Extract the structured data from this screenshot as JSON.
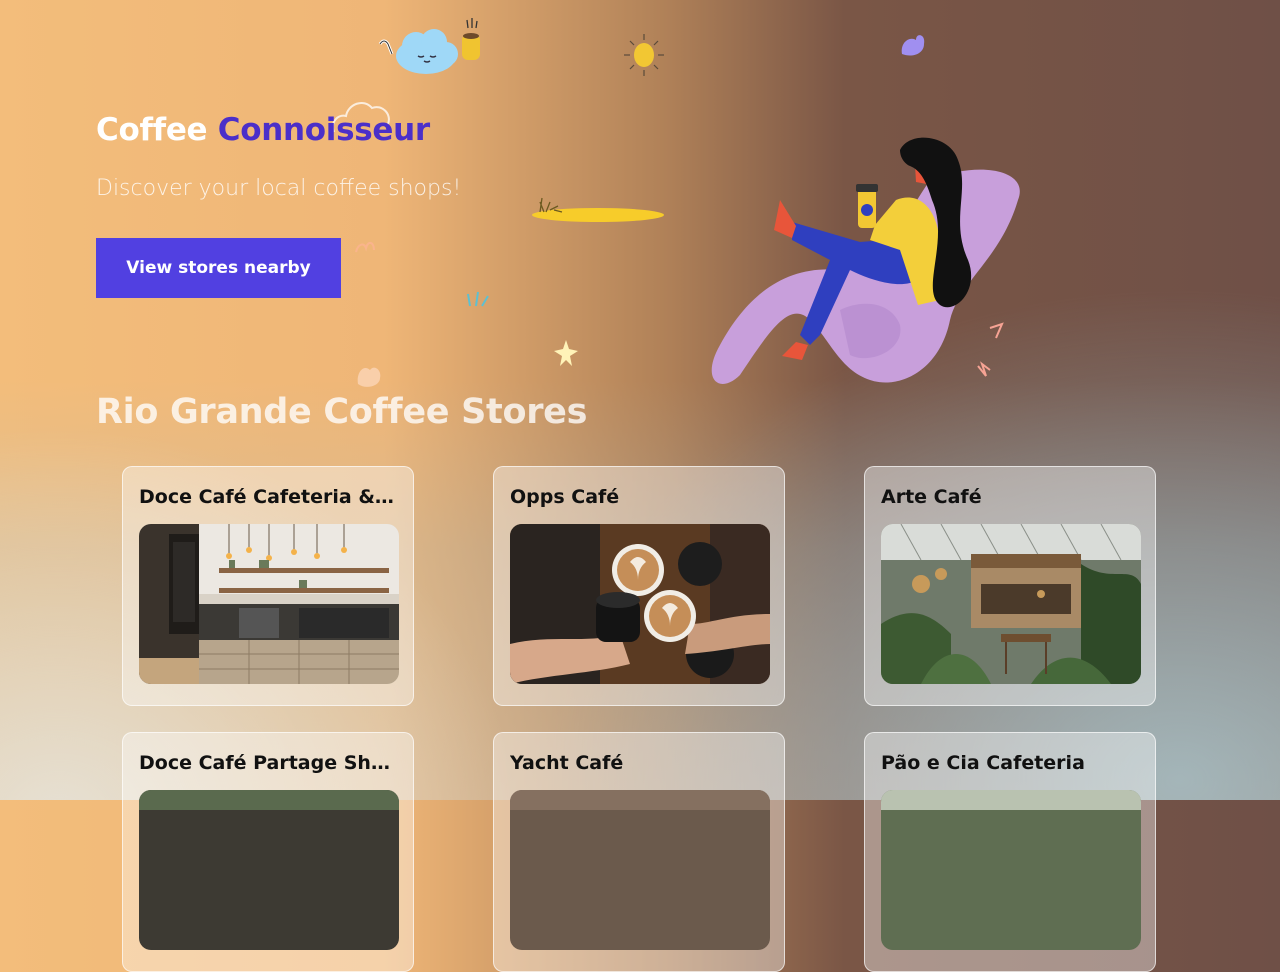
{
  "hero": {
    "title_part1": "Coffee",
    "title_part2": "Connoisseur",
    "subtitle": "Discover your local coffee shops!",
    "cta_label": "View stores nearby"
  },
  "stores_section": {
    "title": "Rio Grande Coffee Stores",
    "cards": [
      {
        "name": "Doce Café Cafeteria & Do...",
        "photo": "cafe-counter-photo"
      },
      {
        "name": "Opps Café",
        "photo": "latte-cheers-photo"
      },
      {
        "name": "Arte Café",
        "photo": "garden-cafe-photo"
      },
      {
        "name": "Doce Café Partage Shopp...",
        "photo": "cafe-photo"
      },
      {
        "name": "Yacht Café",
        "photo": "cafe-photo"
      },
      {
        "name": "Pão e Cia Cafeteria",
        "photo": "cafe-photo"
      }
    ]
  },
  "colors": {
    "accent": "#4b2fc9",
    "button": "#5140e1"
  }
}
